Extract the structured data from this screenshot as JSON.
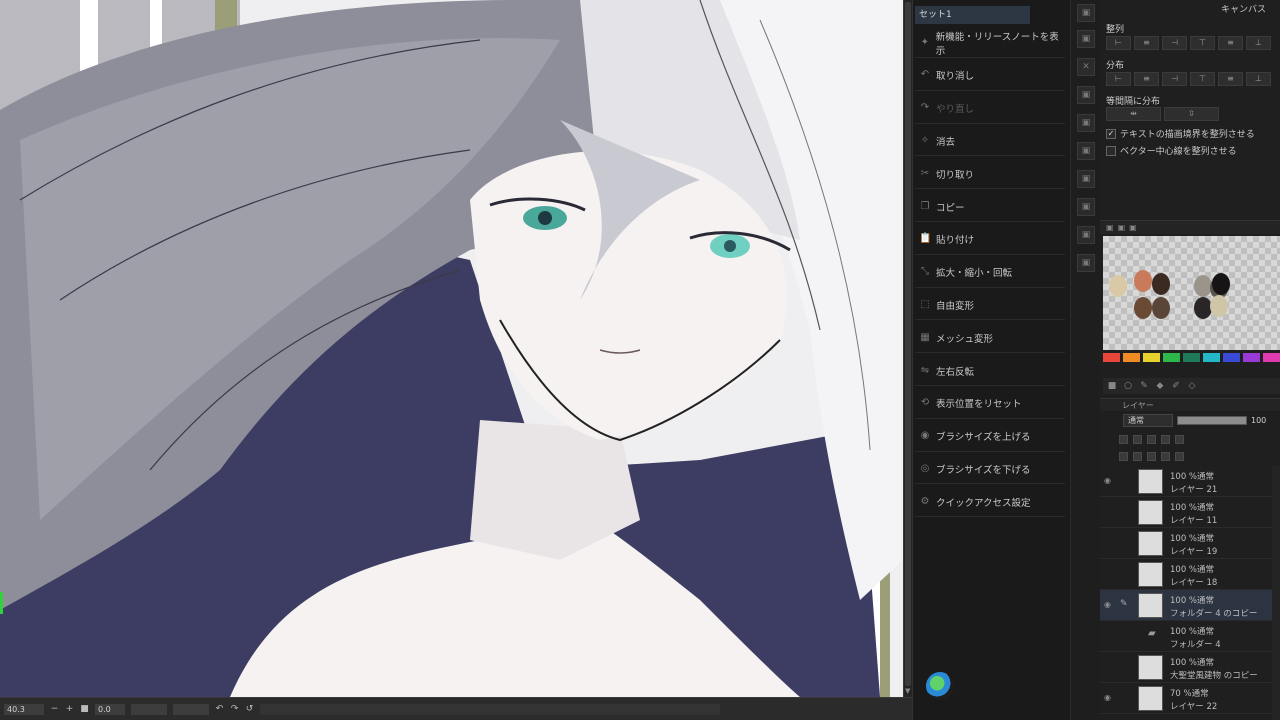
{
  "canvas": {
    "zoom_value": "40.3",
    "rotation_value": "0.0",
    "colors": {
      "hair_dark": "#3d3d63",
      "hair_grey": "#8e8e9a",
      "skin": "#f6f2f2",
      "eyes": "#4aa89a",
      "background": "#efeff1",
      "accent_stripe": "#9c9e78"
    }
  },
  "quick_access": {
    "set_tab": "セット1",
    "items": [
      {
        "label": "新機能・リリースノートを表示",
        "icon": "star-icon",
        "enabled": true
      },
      {
        "label": "取り消し",
        "icon": "undo-icon",
        "enabled": true
      },
      {
        "label": "やり直し",
        "icon": "redo-icon",
        "enabled": false
      },
      {
        "label": "消去",
        "icon": "erase-icon",
        "enabled": true
      },
      {
        "label": "切り取り",
        "icon": "cut-icon",
        "enabled": true
      },
      {
        "label": "コピー",
        "icon": "copy-icon",
        "enabled": true
      },
      {
        "label": "貼り付け",
        "icon": "paste-icon",
        "enabled": true
      },
      {
        "label": "拡大・縮小・回転",
        "icon": "transform-icon",
        "enabled": true
      },
      {
        "label": "自由変形",
        "icon": "free-transform-icon",
        "enabled": true
      },
      {
        "label": "メッシュ変形",
        "icon": "mesh-icon",
        "enabled": true
      },
      {
        "label": "左右反転",
        "icon": "flip-icon",
        "enabled": true
      },
      {
        "label": "表示位置をリセット",
        "icon": "reset-view-icon",
        "enabled": true
      },
      {
        "label": "ブラシサイズを上げる",
        "icon": "brush-up-icon",
        "enabled": true
      },
      {
        "label": "ブラシサイズを下げる",
        "icon": "brush-down-icon",
        "enabled": true
      },
      {
        "label": "クイックアクセス設定",
        "icon": "settings-icon",
        "enabled": true
      }
    ]
  },
  "align_panel": {
    "canvas_label": "キャンバス",
    "align_label": "整列",
    "distribute_label": "分布",
    "equal_label": "等間隔に分布",
    "check_text_bounds": "テキストの描画境界を整列させる",
    "check_vector_center": "ベクター中心線を整列させる",
    "check_text_bounds_checked": true,
    "check_vector_center_checked": false
  },
  "palette": {
    "swatches": [
      "#e8463a",
      "#f08a24",
      "#e8d12c",
      "#2fb84a",
      "#1f7a5a",
      "#23b7c8",
      "#3a49d6",
      "#9a3ad6",
      "#e03ab0"
    ],
    "blobs": [
      "#d9c9a6",
      "#c87a5a",
      "#6b4a35",
      "#3a2a22",
      "#5a4538",
      "#9a948a",
      "#5a5450",
      "#2a2628",
      "#cfc6a8",
      "#161414"
    ]
  },
  "layers": {
    "header": "レイヤー",
    "blend_mode": "通常",
    "opacity": 100,
    "rows": [
      {
        "mode": "100 %通常",
        "name": "レイヤー 21",
        "visible": true,
        "selected": false,
        "folder": false
      },
      {
        "mode": "100 %通常",
        "name": "レイヤー 11",
        "visible": false,
        "selected": false,
        "folder": false
      },
      {
        "mode": "100 %通常",
        "name": "レイヤー 19",
        "visible": false,
        "selected": false,
        "folder": false
      },
      {
        "mode": "100 %通常",
        "name": "レイヤー 18",
        "visible": false,
        "selected": false,
        "folder": false
      },
      {
        "mode": "100 %通常",
        "name": "フォルダー 4 のコピー",
        "visible": true,
        "selected": true,
        "folder": false
      },
      {
        "mode": "100 %通常",
        "name": "フォルダー 4",
        "visible": false,
        "selected": false,
        "folder": true
      },
      {
        "mode": "100 %通常",
        "name": "大聖堂風建物 のコピー",
        "visible": false,
        "selected": false,
        "folder": false
      },
      {
        "mode": "70 %通常",
        "name": "レイヤー 22",
        "visible": true,
        "selected": false,
        "folder": false
      }
    ]
  }
}
